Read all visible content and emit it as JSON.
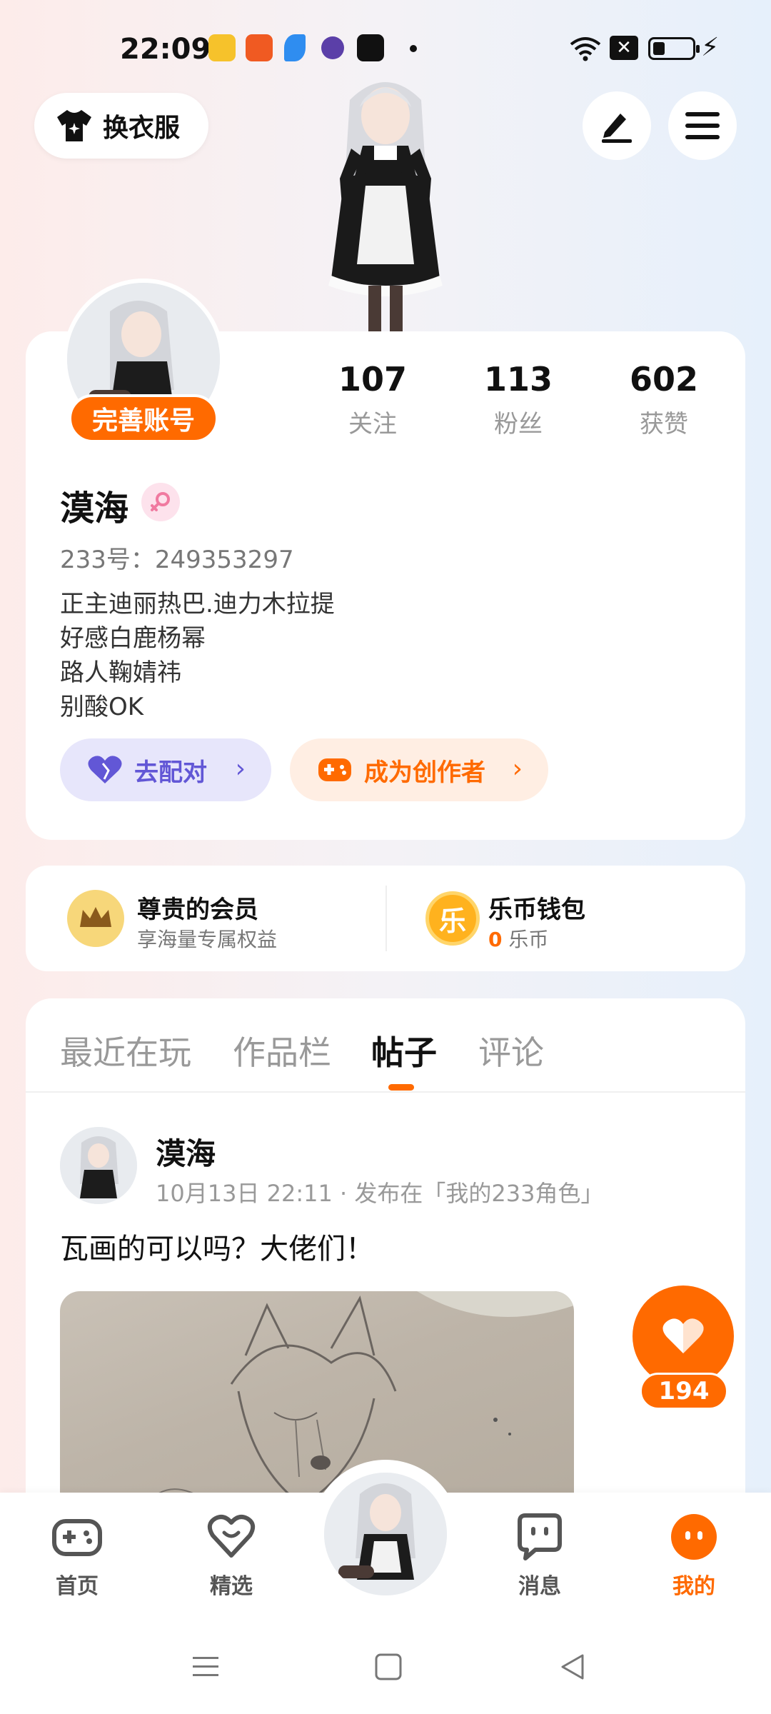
{
  "status_bar": {
    "time": "22:09",
    "sim_icon_text": "✕"
  },
  "header": {
    "change_clothes_label": "换衣服"
  },
  "profile": {
    "complete_account_label": "完善账号",
    "name": "漠海",
    "id_line": "233号：249353297",
    "bio": [
      "正主迪丽热巴.迪力木拉提",
      "好感白鹿杨幂",
      "路人鞠婧祎",
      "别酸OK"
    ],
    "stats": [
      {
        "value": "107",
        "label": "关注"
      },
      {
        "value": "113",
        "label": "粉丝"
      },
      {
        "value": "602",
        "label": "获赞"
      }
    ],
    "match_label": "去配对",
    "creator_label": "成为创作者"
  },
  "wallet": {
    "vip_title": "尊贵的会员",
    "vip_sub": "享海量专属权益",
    "vip_icon_char": "",
    "coin_title": "乐币钱包",
    "coin_amount": "0",
    "coin_unit": "乐币",
    "coin_icon_char": "乐"
  },
  "tabs": [
    {
      "label": "最近在玩",
      "active": false
    },
    {
      "label": "作品栏",
      "active": false
    },
    {
      "label": "帖子",
      "active": true
    },
    {
      "label": "评论",
      "active": false
    }
  ],
  "post": {
    "author": "漠海",
    "meta": "10月13日 22:11 · 发布在「我的233角色」",
    "text": "瓦画的可以吗？大佬们！",
    "likes": "194"
  },
  "bottom_nav": [
    {
      "label": "首页",
      "icon": "gamepad-icon",
      "active": false
    },
    {
      "label": "精选",
      "icon": "heart-chat-icon",
      "active": false
    },
    {
      "label": "消息",
      "icon": "message-icon",
      "active": false
    },
    {
      "label": "我的",
      "icon": "profile-face-icon",
      "active": true
    }
  ],
  "colors": {
    "accent": "#ff6a00",
    "match_purple": "#6257d6",
    "match_bg": "#e7e6fb",
    "creator_bg": "#ffeee3"
  }
}
